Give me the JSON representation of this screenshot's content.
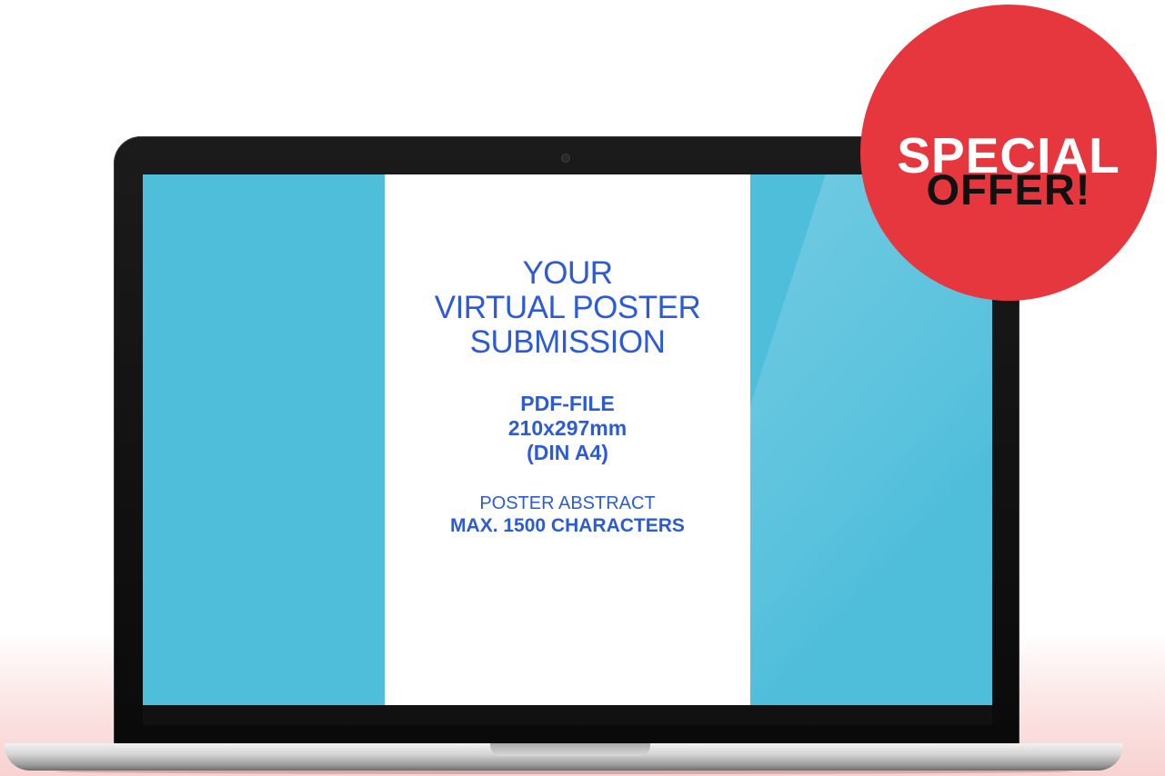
{
  "poster": {
    "title_lines": [
      "YOUR",
      "VIRTUAL POSTER",
      "SUBMISSION"
    ],
    "spec_lines": [
      "PDF-FILE",
      "210x297mm",
      "(DIN A4)"
    ],
    "abstract_label": "POSTER ABSTRACT",
    "abstract_limit": "MAX. 1500 CHARACTERS"
  },
  "badge": {
    "line1": "SPECIAL",
    "line2": "OFFER!"
  },
  "colors": {
    "screen_background": "#4fbedb",
    "poster_text": "#2d5bd8",
    "badge_background": "#e6373f"
  },
  "icons": {
    "camera": "camera-dot-icon"
  }
}
